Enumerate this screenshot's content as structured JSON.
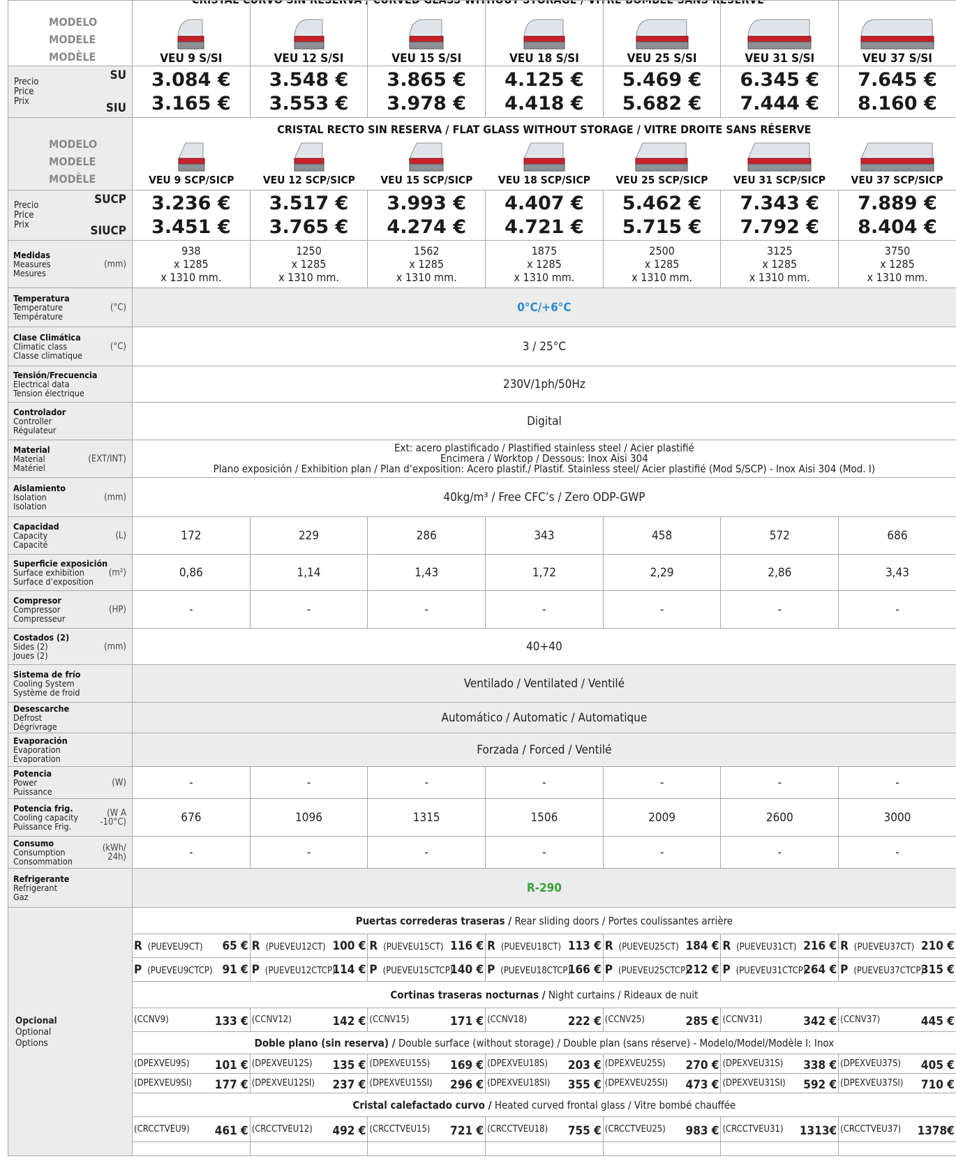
{
  "banner_curved": "CRISTAL CURVO SIN RESERVA / CURVED GLASS WITHOUT STORAGE / VITRE BOMBÉE SANS RÉSERVE",
  "banner_flat": "CRISTAL RECTO SIN RESERVA / FLAT GLASS WITHOUT STORAGE / VITRE DROITE SANS RÉSERVE",
  "model_label": [
    "MODELO",
    "MODELE",
    "MODÈLE"
  ],
  "curved_models": [
    "VEU 9 S/SI",
    "VEU 12 S/SI",
    "VEU  15 S/SI",
    "VEU 18 S/SI",
    "VEU 25 S/SI",
    "VEU 31 S/SI",
    "VEU  37 S/SI"
  ],
  "flat_models": [
    "VEU 9 SCP/SICP",
    "VEU 12 SCP/SICP",
    "VEU 15 SCP/SICP",
    "VEU 18 SCP/SICP",
    "VEU 25 SCP/SICP",
    "VEU 31 SCP/SICP",
    "VEU 37 SCP/SICP"
  ],
  "price_label": {
    "es": "Precio",
    "en": "Price",
    "fr": "Prix"
  },
  "curved_price_codes": [
    "SU",
    "SIU"
  ],
  "flat_price_codes": [
    "SUCP",
    "SIUCP"
  ],
  "curved_prices_su": [
    "3.084 €",
    "3.548 €",
    "3.865 €",
    "4.125 €",
    "5.469 €",
    "6.345 €",
    "7.645 €"
  ],
  "curved_prices_siu": [
    "3.165 €",
    "3.553 €",
    "3.978 €",
    "4.418 €",
    "5.682 €",
    "7.444 €",
    "8.160 €"
  ],
  "flat_prices_sucp": [
    "3.236 €",
    "3.517 €",
    "3.993 €",
    "4.407 €",
    "5.462 €",
    "7.343 €",
    "7.889 €"
  ],
  "flat_prices_siucp": [
    "3.451 €",
    "3.765 €",
    "4.274 €",
    "4.721 €",
    "5.715 €",
    "7.792 €",
    "8.404 €"
  ],
  "measures": {
    "label": [
      "Medidas",
      "Measures",
      "Mesures"
    ],
    "unit": "(mm)",
    "widths": [
      "938",
      "1250",
      "1562",
      "1875",
      "2500",
      "3125",
      "3750"
    ],
    "depth": "x 1285",
    "height": "x 1310 mm."
  },
  "temperature": {
    "label": [
      "Temperatura",
      "Temperature",
      "Température"
    ],
    "unit": "(°C)",
    "value": "0°C/+6°C"
  },
  "climate": {
    "label": [
      "Clase Climática",
      "Climatic class",
      "Classe climatique"
    ],
    "unit": "(°C)",
    "value": "3 / 25°C"
  },
  "voltage": {
    "label": [
      "Tensión/Frecuencia",
      "Electrical data",
      "Tension électrique"
    ],
    "value": "230V/1ph/50Hz"
  },
  "controller": {
    "label": [
      "Controlador",
      "Controller",
      "Régulateur"
    ],
    "value": "Digital"
  },
  "material": {
    "label": [
      "Material",
      "Material",
      "Matériel"
    ],
    "unit": "(EXT/INT)",
    "lines": [
      "Ext: acero plastificado / Plastified stainless steel / Acier plastifié",
      "Encimera / Worktop / Dessous:  Inox Aisi 304",
      "Plano exposición / Exhibition plan / Plan d’exposition:  Acero plastif./ Plastif. Stainless steel/ Acier plastifié (Mod S/SCP) - Inox Aisi 304 (Mod. I)"
    ]
  },
  "isolation": {
    "label": [
      "Aislamiento",
      "Isolation",
      "Isolation"
    ],
    "unit": "(mm)",
    "value": "40kg/m³  /  Free CFC’s  /  Zero ODP-GWP"
  },
  "capacity": {
    "label": [
      "Capacidad",
      "Capacity",
      "Capacité"
    ],
    "unit": "(L)",
    "values": [
      "172",
      "229",
      "286",
      "343",
      "458",
      "572",
      "686"
    ]
  },
  "surface": {
    "label": [
      "Superficie exposición",
      "Surface exhibition",
      "Surface d’exposition"
    ],
    "unit": "(m²)",
    "values": [
      "0,86",
      "1,14",
      "1,43",
      "1,72",
      "2,29",
      "2,86",
      "3,43"
    ]
  },
  "compressor": {
    "label": [
      "Compresor",
      "Compressor",
      "Compresseur"
    ],
    "unit": "(HP)",
    "values": [
      "-",
      "-",
      "-",
      "-",
      "-",
      "-",
      "-"
    ]
  },
  "sides": {
    "label": [
      "Costados (2)",
      "Sides (2)",
      "Joues (2)"
    ],
    "unit": "(mm)",
    "value": "40+40"
  },
  "cooling_system": {
    "label": [
      "Sistema de frío",
      "Cooling System",
      "Système de froid"
    ],
    "value": "Ventilado / Ventilated / Ventilé"
  },
  "defrost": {
    "label": [
      "Desescarche",
      "Defrost",
      "Dégrivrage"
    ],
    "value": "Automático / Automatic / Automatique"
  },
  "evaporation": {
    "label": [
      "Evaporación",
      "Evaporation",
      "Évaporation"
    ],
    "value": "Forzada / Forced / Ventilé"
  },
  "power": {
    "label": [
      "Potencia",
      "Power",
      "Puissance"
    ],
    "unit": "(W)",
    "values": [
      "-",
      "-",
      "-",
      "-",
      "-",
      "-",
      "-"
    ]
  },
  "cooling_capacity": {
    "label": [
      "Potencia frig.",
      "Cooling capacity",
      "Puissance Frig."
    ],
    "unit": [
      "(W A",
      "-10°C)"
    ],
    "values": [
      "676",
      "1096",
      "1315",
      "1506",
      "2009",
      "2600",
      "3000"
    ]
  },
  "consumption": {
    "label": [
      "Consumo",
      "Consumption",
      "Consommation"
    ],
    "unit": [
      "(kWh/",
      "24h)"
    ],
    "values": [
      "-",
      "-",
      "-",
      "-",
      "-",
      "-",
      "-"
    ]
  },
  "refrigerant": {
    "label": [
      "Refrigerante",
      "Refrigerant",
      "Gaz"
    ],
    "value": "R-290"
  },
  "optional": {
    "label": [
      "Opcional",
      "Optional",
      "Options"
    ],
    "doors_head": {
      "bold": "Puertas correderas traseras /",
      "rest": " Rear sliding doors / Portes coulissantes arrière"
    },
    "doors_r": [
      [
        "(PUEVEU9CT)",
        "65 €"
      ],
      [
        "(PUEVEU12CT)",
        "100 €"
      ],
      [
        "(PUEVEU15CT)",
        "116 €"
      ],
      [
        "(PUEVEU18CT)",
        "113 €"
      ],
      [
        "(PUEVEU25CT)",
        "184 €"
      ],
      [
        "(PUEVEU31CT)",
        "216 €"
      ],
      [
        "(PUEVEU37CT)",
        "210 €"
      ]
    ],
    "doors_p": [
      [
        "(PUEVEU9CTCP)",
        "91 €"
      ],
      [
        "(PUEVEU12CTCP)",
        "114 €"
      ],
      [
        "(PUEVEU15CTCP)",
        "140 €"
      ],
      [
        "(PUEVEU18CTCP)",
        "166 €"
      ],
      [
        "(PUEVEU25CTCP)",
        "212 €"
      ],
      [
        "(PUEVEU31CTCP)",
        "264 €"
      ],
      [
        "(PUEVEU37CTCP)",
        "315 €"
      ]
    ],
    "curtains_head": {
      "bold": "Cortinas traseras nocturnas /",
      "rest": " Night curtains / Rideaux de nuit"
    },
    "curtains": [
      [
        "(CCNV9)",
        "133 €"
      ],
      [
        "(CCNV12)",
        "142 €"
      ],
      [
        "(CCNV15)",
        "171 €"
      ],
      [
        "(CCNV18)",
        "222 €"
      ],
      [
        "(CCNV25)",
        "285 €"
      ],
      [
        "(CCNV31)",
        "342 €"
      ],
      [
        "(CCNV37)",
        "445 €"
      ]
    ],
    "double_head": {
      "bold": "Doble plano (sin reserva) /",
      "mid": " Double surface (without storage) /",
      "rest": " Double plan (sans réserve) - Modelo/Model/Modèle I: Inox"
    },
    "double_s": [
      [
        "(DPEXVEU9S)",
        "101 €"
      ],
      [
        "(DPEXVEU12S)",
        "135 €"
      ],
      [
        "(DPEXVEU15S)",
        "169 €"
      ],
      [
        "(DPEXVEU18S)",
        "203 €"
      ],
      [
        "(DPEXVEU25S)",
        "270 €"
      ],
      [
        "(DPEXVEU31S)",
        "338 €"
      ],
      [
        "(DPEXVEU37S)",
        "405 €"
      ]
    ],
    "double_si": [
      [
        "(DPEXVEU9SI)",
        "177 €"
      ],
      [
        "(DPEXVEU12SI)",
        "237 €"
      ],
      [
        "(DPEXVEU15SI)",
        "296 €"
      ],
      [
        "(DPEXVEU18SI)",
        "355 €"
      ],
      [
        "(DPEXVEU25SI)",
        "473 €"
      ],
      [
        "(DPEXVEU31SI)",
        "592 €"
      ],
      [
        "(DPEXVEU37SI)",
        "710 €"
      ]
    ],
    "glass_head": {
      "bold": "Cristal calefactado curvo /",
      "rest": " Heated curved frontal glass / Vitre bombé chauffée"
    },
    "glass": [
      [
        "(CRCCTVEU9)",
        "461 €"
      ],
      [
        "(CRCCTVEU12)",
        "492 €"
      ],
      [
        "(CRCCTVEU15)",
        "721 €"
      ],
      [
        "(CRCCTVEU18)",
        "755 €"
      ],
      [
        "(CRCCTVEU25)",
        "983 €"
      ],
      [
        "(CRCCTVEU31)",
        "1313€"
      ],
      [
        "(CRCCTVEU37)",
        "1378€"
      ]
    ],
    "row_letter_r": "R",
    "row_letter_p": "P"
  },
  "colors": {
    "label_bg": "#ececec",
    "border": "#a9a9a9",
    "temp_blue": "#2a8dd4",
    "gas_green": "#3aa33a",
    "case_red": "#c8202a"
  }
}
